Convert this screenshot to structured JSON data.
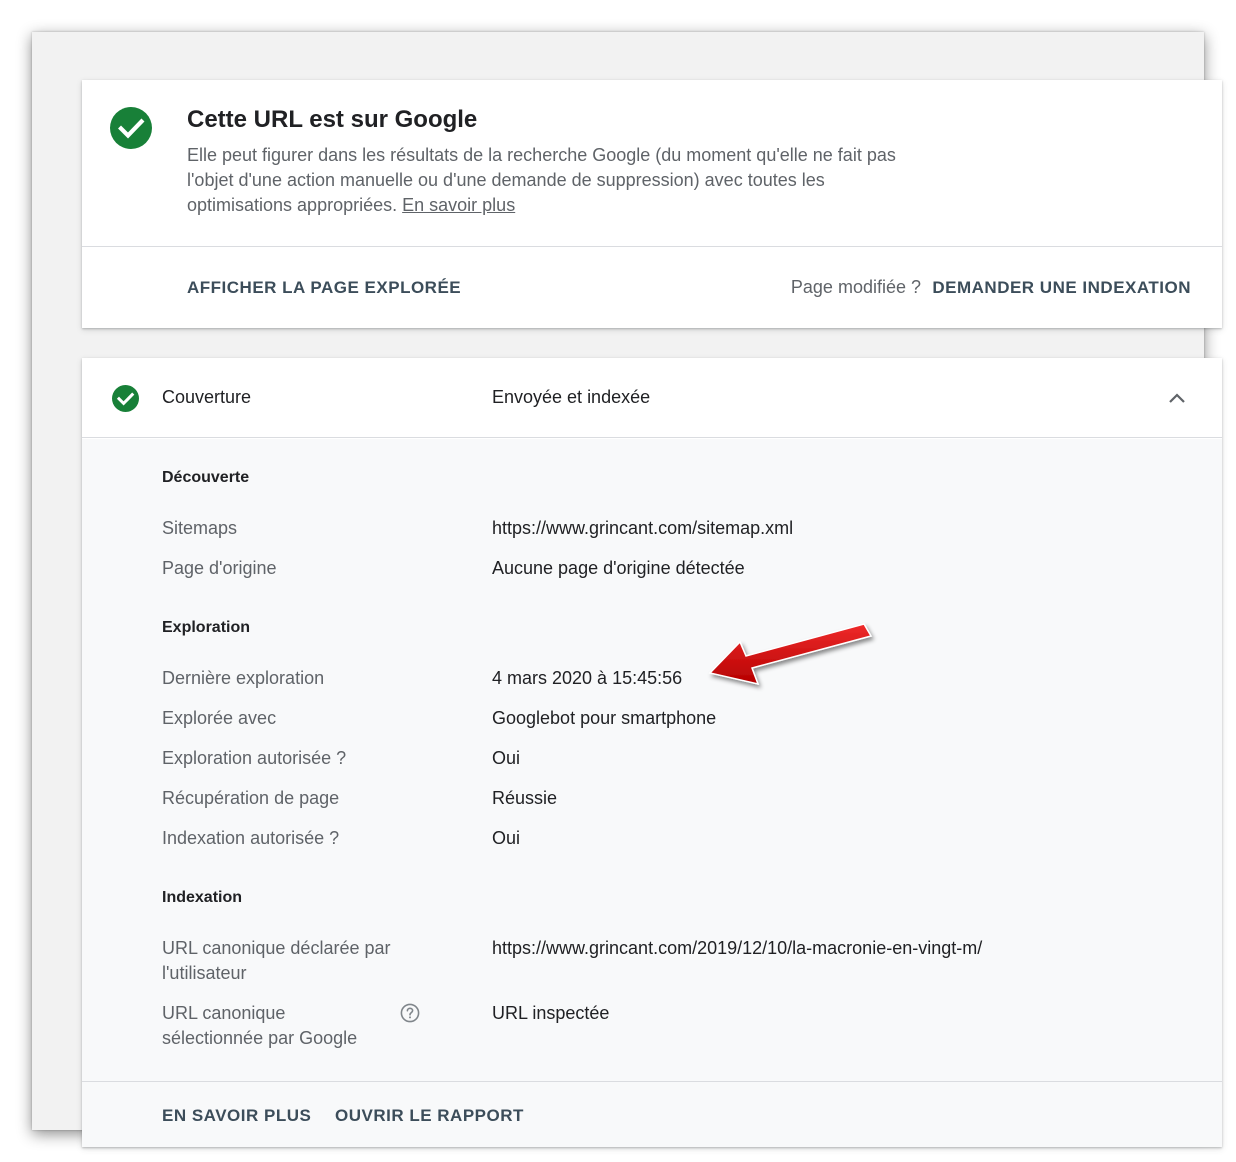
{
  "status_card": {
    "title": "Cette URL est sur Google",
    "description": "Elle peut figurer dans les résultats de la recherche Google (du moment qu'elle ne fait pas l'objet d'une action manuelle ou d'une demande de suppression) avec toutes les optimisations appropriées.",
    "learn_more_link": "En savoir plus",
    "view_crawled_label": "AFFICHER LA PAGE EXPLORÉE",
    "page_modified_text": "Page modifiée ?",
    "request_indexing_label": "DEMANDER UNE INDEXATION"
  },
  "coverage": {
    "label": "Couverture",
    "value": "Envoyée et indexée",
    "sections": {
      "discovery": {
        "title": "Découverte",
        "sitemaps_label": "Sitemaps",
        "sitemaps_value": "https://www.grincant.com/sitemap.xml",
        "referring_label": "Page d'origine",
        "referring_value": "Aucune page d'origine détectée"
      },
      "crawl": {
        "title": "Exploration",
        "last_crawl_label": "Dernière exploration",
        "last_crawl_value": "4 mars 2020 à 15:45:56",
        "crawled_as_label": "Explorée avec",
        "crawled_as_value": "Googlebot pour smartphone",
        "crawl_allowed_label": "Exploration autorisée ?",
        "crawl_allowed_value": "Oui",
        "page_fetch_label": "Récupération de page",
        "page_fetch_value": "Réussie",
        "indexing_allowed_label": "Indexation autorisée ?",
        "indexing_allowed_value": "Oui"
      },
      "indexing": {
        "title": "Indexation",
        "user_canonical_label": "URL canonique déclarée par l'utilisateur",
        "user_canonical_value": "https://www.grincant.com/2019/12/10/la-macronie-en-vingt-m/",
        "google_canonical_label": "URL canonique sélectionnée par Google",
        "google_canonical_value": "URL inspectée"
      }
    },
    "footer": {
      "learn_more_label": "EN SAVOIR PLUS",
      "open_report_label": "OUVRIR LE RAPPORT"
    }
  },
  "colors": {
    "success_green": "#188038",
    "action_text": "#3c4d5a",
    "annotation_red": "#d10a0a"
  },
  "icons": {
    "status": "check-circle-icon",
    "coverage": "check-circle-icon",
    "collapse": "chevron-up-icon",
    "help": "help-circle-icon",
    "annotation": "red-arrow-icon"
  }
}
